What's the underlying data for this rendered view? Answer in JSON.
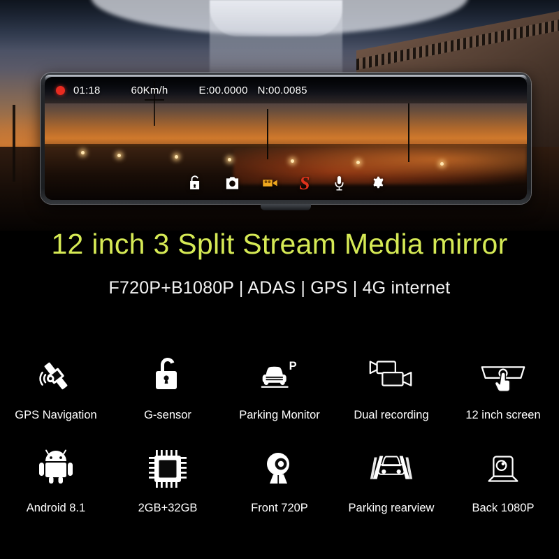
{
  "product": {
    "headline": "12 inch 3 Split Stream Media mirror",
    "subtitle": "F720P+B1080P | ADAS | GPS | 4G internet",
    "headline_color": "#d6ea55",
    "subtitle_color": "#f2f2f2",
    "background_color": "#000000"
  },
  "device": {
    "status_bar": {
      "recording_indicator": "record-dot",
      "recording_color": "#e82b20",
      "time": "01:18",
      "speed": "60Km/h",
      "longitude": "E:00.0000",
      "latitude": "N:00.0085"
    },
    "toolbar": [
      {
        "name": "unlock-icon",
        "label": "Lock",
        "color": "#ffffff"
      },
      {
        "name": "camera-icon",
        "label": "Photo",
        "color": "#ffffff"
      },
      {
        "name": "camcorder-icon",
        "label": "Record",
        "color": "#f0a81e"
      },
      {
        "name": "s-logo-icon",
        "label": "S",
        "color": "#e0321c"
      },
      {
        "name": "microphone-icon",
        "label": "Mic",
        "color": "#ffffff"
      },
      {
        "name": "gear-icon",
        "label": "Settings",
        "color": "#ffffff"
      }
    ]
  },
  "features": {
    "row1": [
      {
        "icon": "satellite-icon",
        "label": "GPS Navigation"
      },
      {
        "icon": "unlock-padlock-icon",
        "label": "G-sensor"
      },
      {
        "icon": "parking-car-icon",
        "label": "Parking Monitor"
      },
      {
        "icon": "dual-camcorder-icon",
        "label": "Dual recording"
      },
      {
        "icon": "touch-mirror-icon",
        "label": "12 inch screen"
      }
    ],
    "row2": [
      {
        "icon": "android-robot-icon",
        "label": "Android 8.1"
      },
      {
        "icon": "cpu-chip-icon",
        "label": "2GB+32GB"
      },
      {
        "icon": "webcam-icon",
        "label": "Front 720P"
      },
      {
        "icon": "car-guidelines-icon",
        "label": "Parking rearview"
      },
      {
        "icon": "rear-camera-icon",
        "label": "Back 1080P"
      }
    ]
  }
}
